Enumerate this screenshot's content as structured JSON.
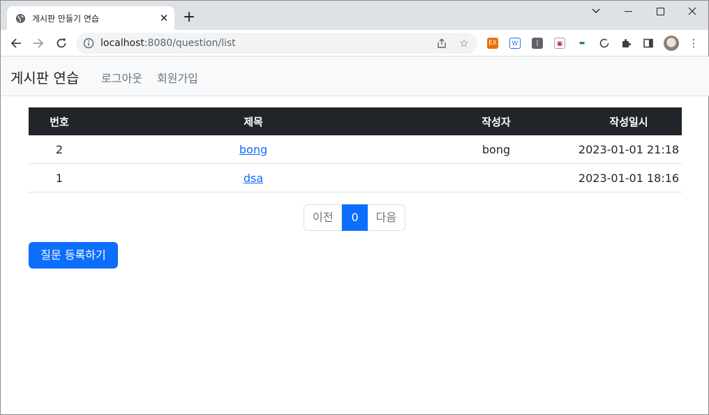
{
  "browser": {
    "tab_title": "게시판 만들기 연습",
    "url_host": "localhost",
    "url_path": ":8080/question/list",
    "extensions": [
      {
        "name": "ex-extension-icon",
        "label": "EX",
        "color": "#e8710a"
      },
      {
        "name": "shield-extension-icon",
        "label": "W",
        "color": "#1a73e8"
      },
      {
        "name": "pipe-extension-icon",
        "label": "|",
        "color": "#5f6368"
      },
      {
        "name": "picture-extension-icon",
        "label": "▣",
        "color": "#c5221f"
      },
      {
        "name": "green-extension-icon",
        "label": "▬",
        "color": "#1e8e3e"
      }
    ]
  },
  "navbar": {
    "brand": "게시판 연습",
    "links": [
      "로그아웃",
      "회원가입"
    ]
  },
  "table": {
    "headers": [
      "번호",
      "제목",
      "작성자",
      "작성일시"
    ],
    "rows": [
      {
        "num": "2",
        "subject": "bong",
        "author": "bong",
        "date": "2023-01-01 21:18"
      },
      {
        "num": "1",
        "subject": "dsa",
        "author": "",
        "date": "2023-01-01 18:16"
      }
    ]
  },
  "pagination": {
    "prev": "이전",
    "current": "0",
    "next": "다음"
  },
  "actions": {
    "create_question": "질문 등록하기"
  },
  "colors": {
    "primary": "#0d6efd",
    "table_head": "#212529"
  }
}
